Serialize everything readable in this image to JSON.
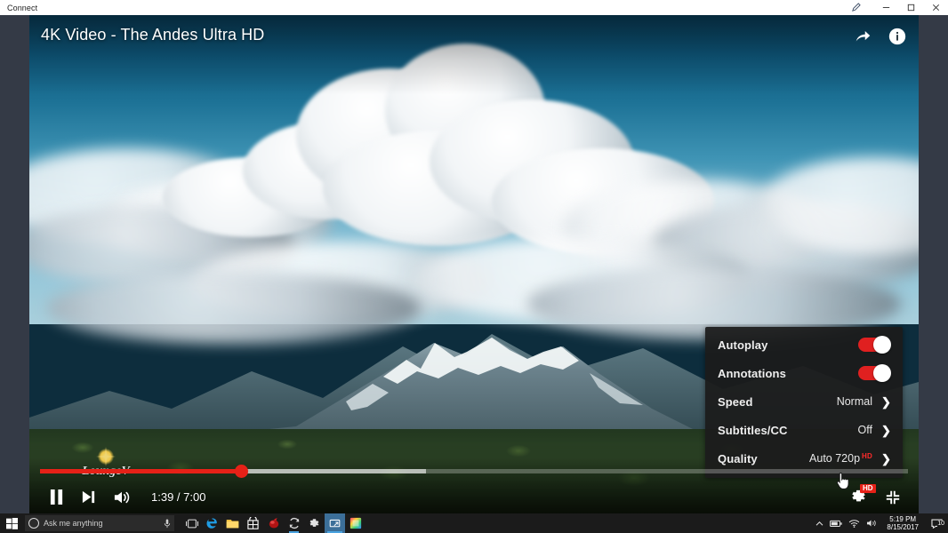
{
  "window": {
    "title": "Connect",
    "controls": {
      "pen": "pen-icon",
      "minimize": "minimize-button",
      "maximize": "maximize-button",
      "close": "close-button"
    }
  },
  "player": {
    "video_title": "4K Video - The Andes Ultra HD",
    "watermark": "LoungeV",
    "header_actions": [
      {
        "name": "share-icon",
        "label": "Share"
      },
      {
        "name": "info-icon",
        "label": "More info"
      }
    ],
    "controls": {
      "play_pause": "pause-button",
      "next": "next-video-button",
      "volume": "volume-button",
      "time_current": "1:39",
      "time_total": "7:00",
      "time_display": "1:39 / 7:00",
      "settings": "settings-gear-button",
      "settings_hd_badge": "HD",
      "fullscreen": "exit-fullscreen-button"
    },
    "progress": {
      "played_percent": 23.2,
      "buffered_percent": 44.5,
      "accent_color": "#e62117"
    }
  },
  "settings_menu": {
    "rows": [
      {
        "label": "Autoplay",
        "type": "toggle",
        "value": "On",
        "on": true
      },
      {
        "label": "Annotations",
        "type": "toggle",
        "value": "On",
        "on": true
      },
      {
        "label": "Speed",
        "type": "submenu",
        "value": "Normal"
      },
      {
        "label": "Subtitles/CC",
        "type": "submenu",
        "value": "Off"
      },
      {
        "label": "Quality",
        "type": "submenu",
        "value": "Auto 720p",
        "badge": "HD"
      }
    ]
  },
  "taskbar": {
    "start": "windows-start-button",
    "search_placeholder": "Ask me anything",
    "apps": [
      {
        "name": "task-view-button",
        "label": "Task View"
      },
      {
        "name": "taskbar-app-edge",
        "label": "Microsoft Edge"
      },
      {
        "name": "taskbar-app-explorer",
        "label": "File Explorer"
      },
      {
        "name": "taskbar-app-store",
        "label": "Microsoft Store"
      },
      {
        "name": "taskbar-app-red",
        "label": "Media App"
      },
      {
        "name": "taskbar-app-sync",
        "label": "Sync"
      },
      {
        "name": "taskbar-app-settings",
        "label": "Settings"
      },
      {
        "name": "taskbar-app-connect",
        "label": "Connect"
      },
      {
        "name": "taskbar-app-photos",
        "label": "Photos"
      }
    ],
    "tray": {
      "show_hidden": "show-hidden-icons",
      "battery": "battery-icon",
      "network": "network-icon",
      "volume": "volume-tray-icon",
      "time": "5:19 PM",
      "date": "8/15/2017",
      "action_center": "action-center-button"
    }
  }
}
